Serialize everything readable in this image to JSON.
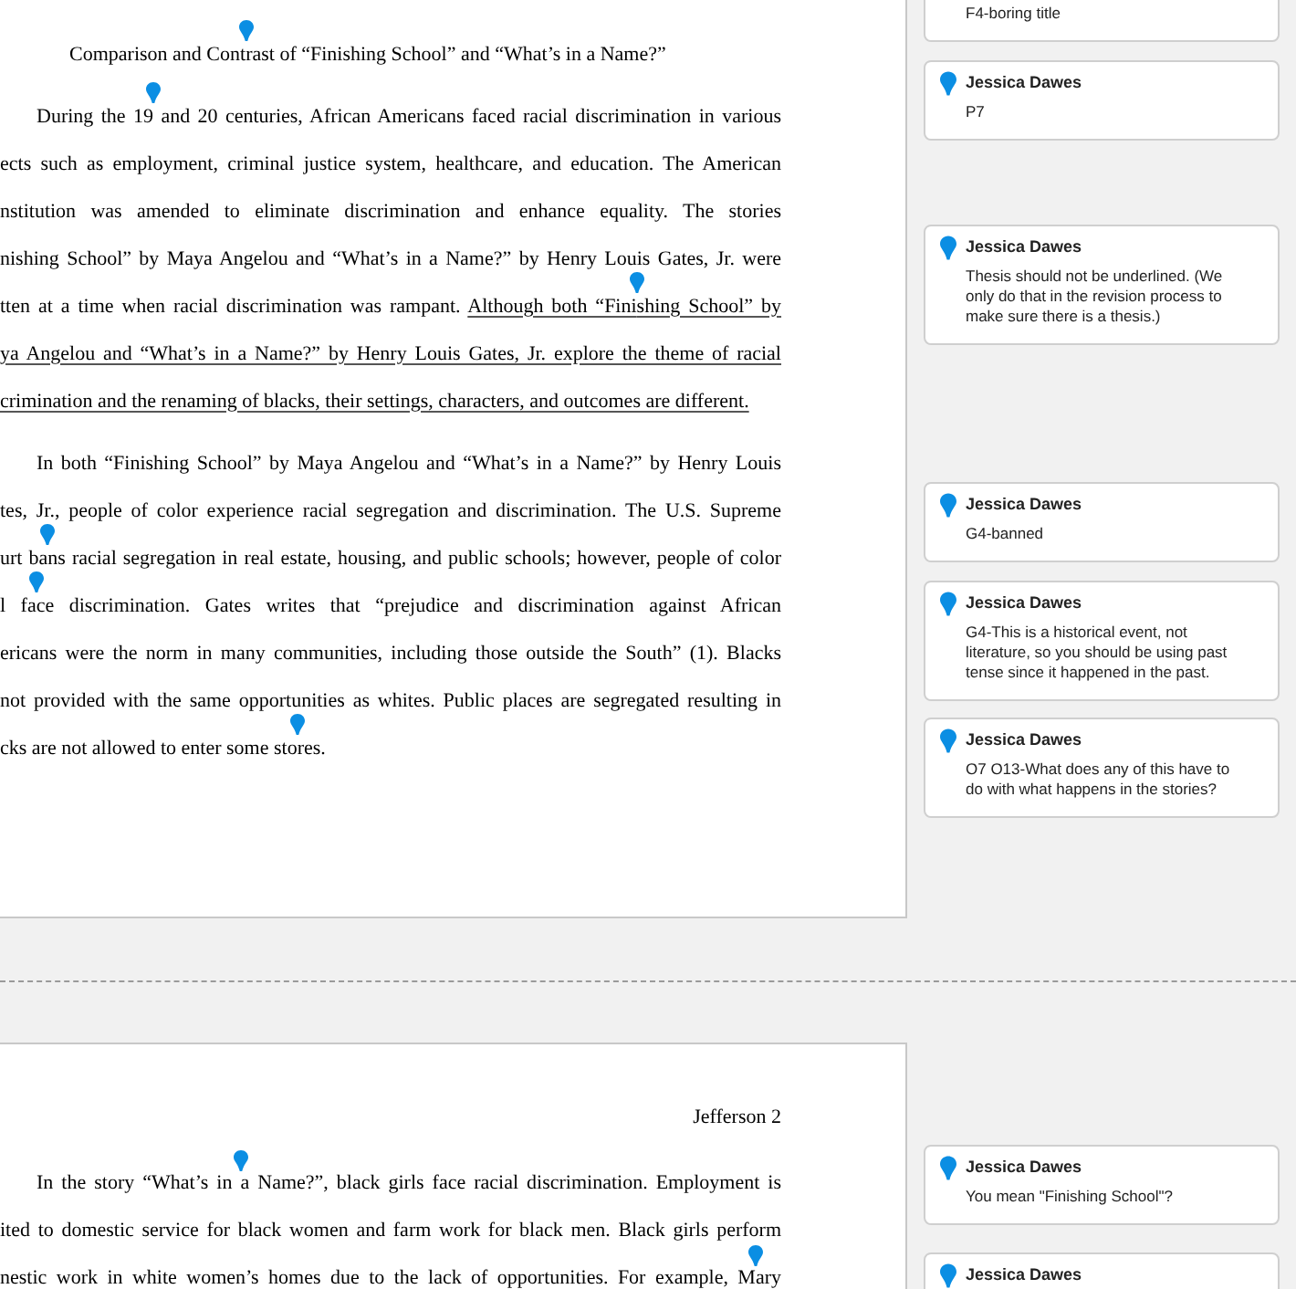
{
  "pages": [
    {
      "lines": [
        {
          "kind": "title",
          "segments": [
            {
              "text": "Comparison and Cont",
              "underlined": false
            },
            {
              "kind": "pin"
            },
            {
              "text": "rast of “Finishing School” and “What’s in a Name?”",
              "underlined": false
            }
          ]
        },
        {
          "kind": "indent",
          "segments": [
            {
              "text": "During the 19",
              "underlined": false
            },
            {
              "kind": "pin"
            },
            {
              "text": " and 20 centuries, African Americans faced racial discrimination in various",
              "underlined": false
            }
          ]
        },
        {
          "kind": "full",
          "segments": [
            {
              "text": "ects such as employment, criminal justice system, healthcare, and education. The American",
              "underlined": false
            }
          ]
        },
        {
          "kind": "full",
          "segments": [
            {
              "text": "nstitution was amended to eliminate discrimination and enhance equality. The stories",
              "underlined": false
            }
          ]
        },
        {
          "kind": "full",
          "segments": [
            {
              "text": "nishing School” by Maya Angelou and “What’s in a Name?” by Henry Louis Gates, Jr. were",
              "underlined": false
            }
          ]
        },
        {
          "kind": "full",
          "segments": [
            {
              "text": "tten at a time when racial discrimination was rampant. ",
              "underlined": false
            },
            {
              "text": "Although both “Fini",
              "underlined": true
            },
            {
              "kind": "pin"
            },
            {
              "text": "shing School” by",
              "underlined": true
            }
          ]
        },
        {
          "kind": "full",
          "segments": [
            {
              "text": "ya Angelou and “What’s in a Name?” by Henry Louis Gates, Jr. explore the theme of racial",
              "underlined": true
            }
          ]
        },
        {
          "kind": "end",
          "segments": [
            {
              "text": "crimination and the renaming of blacks, their settings, characters, and outcomes are different.",
              "underlined": true
            }
          ]
        },
        {
          "kind": "indent",
          "gap": true,
          "segments": [
            {
              "text": "In both “Finishing School” by Maya Angelou and “What’s in a Name?” by Henry Louis",
              "underlined": false
            }
          ]
        },
        {
          "kind": "full",
          "segments": [
            {
              "text": "tes, Jr., people of color experience racial segregation and discrimination. The U.S. Supreme",
              "underlined": false
            }
          ]
        },
        {
          "kind": "full",
          "segments": [
            {
              "text": "urt ba",
              "underlined": false
            },
            {
              "kind": "pin"
            },
            {
              "text": "ns racial segregation in real estate, housing, and public schools; however, people of color",
              "underlined": false
            }
          ]
        },
        {
          "kind": "full",
          "segments": [
            {
              "text": "l fa",
              "underlined": false
            },
            {
              "kind": "pin"
            },
            {
              "text": "ce discrimination. Gates writes that “prejudice and discrimination against African",
              "underlined": false
            }
          ]
        },
        {
          "kind": "full",
          "segments": [
            {
              "text": "ericans were the norm in many communities, including those outside the South” (1). Blacks",
              "underlined": false
            }
          ]
        },
        {
          "kind": "full",
          "segments": [
            {
              "text": "not provided with the same opportunities as whites. Public places are segregated resulting in",
              "underlined": false
            }
          ]
        },
        {
          "kind": "end",
          "segments": [
            {
              "text": "cks are not allowed to enter some sto",
              "underlined": false
            },
            {
              "kind": "pin"
            },
            {
              "text": "res.",
              "underlined": false
            }
          ]
        }
      ]
    },
    {
      "lines": [
        {
          "kind": "header",
          "segments": [
            {
              "text": "Jefferson 2",
              "underlined": false
            }
          ]
        },
        {
          "kind": "indent",
          "segments": [
            {
              "text": "In the story “What’s in ",
              "underlined": false
            },
            {
              "kind": "pin"
            },
            {
              "text": "a Name?”, black girls face racial discrimination. Employment is",
              "underlined": false
            }
          ]
        },
        {
          "kind": "full",
          "segments": [
            {
              "text": "ited to domestic service for black women and farm work for black men. Black girls perform",
              "underlined": false
            }
          ]
        },
        {
          "kind": "full",
          "segments": [
            {
              "text": "nestic work in white women’s homes due to the lack of opportunities. For example, M",
              "underlined": false
            },
            {
              "kind": "pin"
            },
            {
              "text": "ary",
              "underlined": false
            }
          ]
        }
      ]
    }
  ],
  "comments": [
    {
      "text": "F4-boring title"
    },
    {
      "author": "Jessica Dawes",
      "text": "P7"
    },
    {
      "author": "Jessica Dawes",
      "text": "Thesis should not be underlined. (We only do that in the revision process to make sure there is a thesis.)"
    },
    {
      "author": "Jessica Dawes",
      "text": "G4-banned"
    },
    {
      "author": "Jessica Dawes",
      "text": "G4-This is a historical event, not literature, so you should be using past tense since it happened in the past."
    },
    {
      "author": "Jessica Dawes",
      "text": "O7 O13-What does any of this have to do with what happens in the stories?"
    },
    {
      "author": "Jessica Dawes",
      "text": "You mean \"Finishing School\"?"
    },
    {
      "author": "Jessica Dawes"
    }
  ]
}
